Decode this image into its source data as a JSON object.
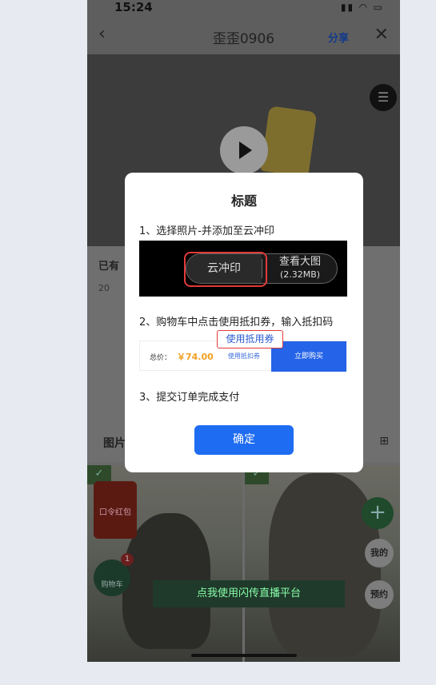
{
  "status_bar": {
    "time": "15:24"
  },
  "nav": {
    "title": "歪歪0906",
    "share": "分享"
  },
  "info": {
    "heading_prefix": "已有",
    "date_prefix": "20",
    "gallery_label": "图片"
  },
  "photo_area": {
    "red_envelope_text": "口令红包",
    "cart_label": "购物车",
    "cart_badge": "1",
    "mine_label": "我的",
    "book_label": "预约",
    "live_banner": "点我使用闪传直播平台"
  },
  "modal": {
    "title": "标题",
    "step1": "1、选择照片-并添加至云冲印",
    "demo1": {
      "cloud_print": "云冲印",
      "view_large": "查看大图",
      "size": "(2.32MB)"
    },
    "step2": "2、购物车中点击使用抵扣券，输入抵扣码",
    "demo2": {
      "total_label": "总价：",
      "total_value": "￥74.00",
      "coupon_link": "使用抵扣券",
      "buy_now": "立即购买"
    },
    "coupon_callout": "使用抵用券",
    "step3": "3、提交订单完成支付",
    "confirm": "确定"
  }
}
